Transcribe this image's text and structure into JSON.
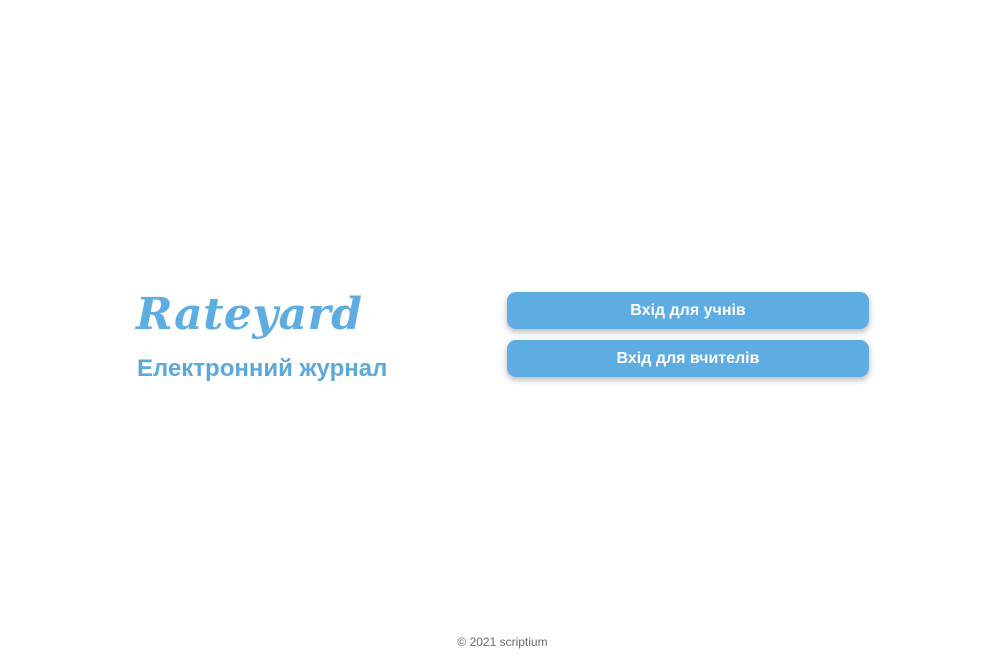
{
  "brand": {
    "logo_text": "Rateyard",
    "subtitle": "Електронний журнал"
  },
  "actions": {
    "student_login_label": "Вхід для учнів",
    "teacher_login_label": "Вхід для вчителів"
  },
  "footer": {
    "copyright": "© 2021 scriptium"
  },
  "colors": {
    "accent": "#5dade2",
    "button_text": "#ffffff",
    "background": "#ffffff",
    "footer_text": "#6b6b6b"
  }
}
